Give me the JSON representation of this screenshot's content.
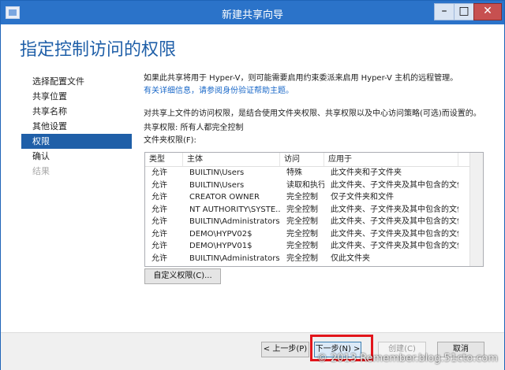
{
  "window": {
    "title": "新建共享向导",
    "buttons": {
      "minimize": "–",
      "maximize": "□",
      "close": "✕"
    }
  },
  "page_title": "指定控制访问的权限",
  "nav": {
    "items": [
      {
        "label": "选择配置文件",
        "state": "normal"
      },
      {
        "label": "共享位置",
        "state": "normal"
      },
      {
        "label": "共享名称",
        "state": "normal"
      },
      {
        "label": "其他设置",
        "state": "normal"
      },
      {
        "label": "权限",
        "state": "active"
      },
      {
        "label": "确认",
        "state": "normal"
      },
      {
        "label": "结果",
        "state": "disabled"
      }
    ]
  },
  "content": {
    "intro": "如果此共享将用于 Hyper-V，则可能需要启用约束委派来启用 Hyper-V 主机的远程管理。",
    "help_link": "有关详细信息，请参阅身份验证帮助主题。",
    "description": "对共享上文件的访问权限，是结合使用文件夹权限、共享权限以及中心访问策略(可选)而设置的。",
    "share_permission": "共享权限: 所有人都完全控制",
    "folder_permission_label": "文件夹权限(F):"
  },
  "table": {
    "headers": [
      "类型",
      "主体",
      "访问",
      "应用于"
    ],
    "rows": [
      [
        "允许",
        "BUILTIN\\Users",
        "特殊",
        "此文件夹和子文件夹"
      ],
      [
        "允许",
        "BUILTIN\\Users",
        "读取和执行",
        "此文件夹、子文件夹及其中包含的文件"
      ],
      [
        "允许",
        "CREATOR OWNER",
        "完全控制",
        "仅子文件夹和文件"
      ],
      [
        "允许",
        "NT AUTHORITY\\SYSTE...",
        "完全控制",
        "此文件夹、子文件夹及其中包含的文件"
      ],
      [
        "允许",
        "BUILTIN\\Administrators",
        "完全控制",
        "此文件夹、子文件夹及其中包含的文件"
      ],
      [
        "允许",
        "DEMO\\HYPV02$",
        "完全控制",
        "此文件夹、子文件夹及其中包含的文件"
      ],
      [
        "允许",
        "DEMO\\HYPV01$",
        "完全控制",
        "此文件夹、子文件夹及其中包含的文件"
      ],
      [
        "允许",
        "BUILTIN\\Administrators",
        "完全控制",
        "仅此文件夹"
      ]
    ]
  },
  "buttons": {
    "custom_permissions": "自定义权限(C)...",
    "prev": "< 上一步(P)",
    "next": "下一步(N) >",
    "create": "创建(C)",
    "cancel": "取消"
  },
  "watermark": "© 2013 Remember.blog.51cto.com",
  "colors": {
    "accent": "#1f5fa8",
    "titlebar": "#2b73c9",
    "highlight": "#e2151b",
    "close": "#c75050"
  }
}
